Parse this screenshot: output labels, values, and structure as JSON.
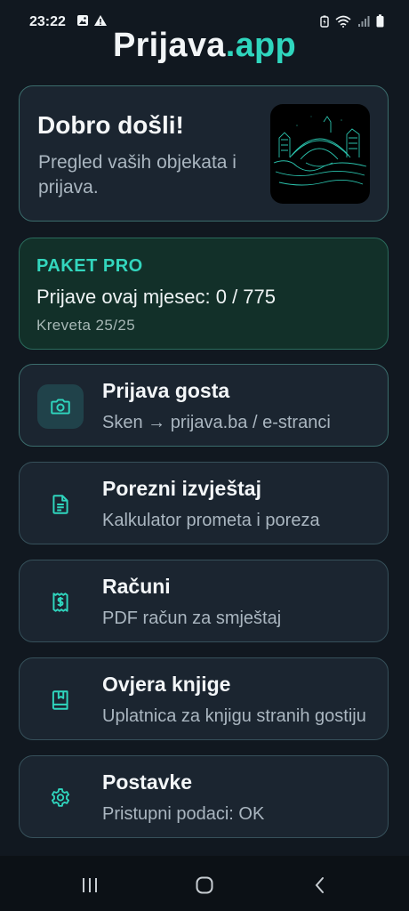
{
  "status_bar": {
    "time": "23:22",
    "left_icons": [
      "image-icon",
      "warning-icon"
    ],
    "right_icons": [
      "battery-saver-icon",
      "wifi-icon",
      "signal-icon",
      "battery-icon"
    ]
  },
  "header": {
    "title_main": "Prijava",
    "title_accent": ".app"
  },
  "welcome": {
    "title": "Dobro došli!",
    "subtitle": "Pregled vaših objekata i prijava."
  },
  "package": {
    "name": "PAKET PRO",
    "usage": "Prijave ovaj mjesec: 0 / 775",
    "beds": "Kreveta 25/25"
  },
  "menu": [
    {
      "icon": "camera-icon",
      "title": "Prijava gosta",
      "subtitle": "Sken → prijava.ba / e-stranci",
      "active": true
    },
    {
      "icon": "document-icon",
      "title": "Porezni izvještaj",
      "subtitle": "Kalkulator prometa i poreza",
      "active": false
    },
    {
      "icon": "receipt-icon",
      "title": "Računi",
      "subtitle": "PDF račun za smještaj",
      "active": false
    },
    {
      "icon": "book-icon",
      "title": "Ovjera knjige",
      "subtitle": "Uplatnica za knjigu stranih gostiju",
      "active": false
    },
    {
      "icon": "gear-icon",
      "title": "Postavke",
      "subtitle": "Pristupni podaci: OK",
      "active": false
    }
  ],
  "nav": [
    "recent-apps-icon",
    "home-icon",
    "back-icon"
  ],
  "colors": {
    "accent": "#2fd6be",
    "background": "#111820",
    "card": "#1b2530",
    "package_card": "#123029"
  }
}
